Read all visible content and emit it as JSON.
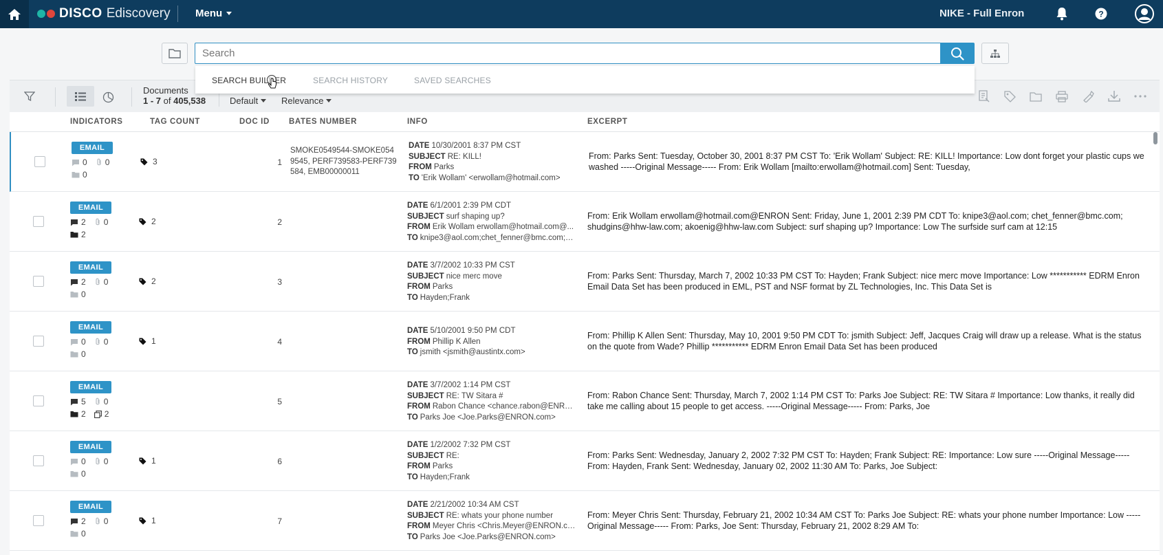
{
  "topbar": {
    "brand": "DISCO",
    "product": "Ediscovery",
    "menu_label": "Menu",
    "workspace": "NIKE - Full Enron",
    "icons": [
      "home-icon",
      "bell-icon",
      "help-icon",
      "user-avatar-icon"
    ],
    "colors": {
      "bar": "#0e3c5e",
      "logo_teal": "#1fb5a6",
      "logo_red": "#e0463c"
    }
  },
  "search": {
    "placeholder": "Search",
    "tabs": [
      "SEARCH BUILDER",
      "SEARCH HISTORY",
      "SAVED SEARCHES"
    ]
  },
  "toolbar": {
    "documents_label": "Documents",
    "range": "1 - 7",
    "of": "of",
    "total": "405,538",
    "sort_view": "Default",
    "sort_order": "Relevance"
  },
  "columns": [
    "INDICATORS",
    "TAG COUNT",
    "DOC ID",
    "BATES NUMBER",
    "INFO",
    "EXCERPT"
  ],
  "rows": [
    {
      "type": "EMAIL",
      "notes": "0",
      "attachments": "0",
      "folders": "0",
      "tag_count": "3",
      "doc_id": "1",
      "bates": "SMOKE0549544-SMOKE0549545, PERF739583-PERF739584, EMB00000011",
      "date": "10/30/2001 8:37 PM CST",
      "subject": "RE: KILL!",
      "from": "Parks",
      "to": "'Erik Wollam' <erwollam@hotmail.com>",
      "excerpt": "From: Parks Sent: Tuesday, October 30, 2001 8:37 PM CST To: 'Erik Wollam' Subject: RE: KILL! Importance: Low dont forget your plastic cups we washed -----Original Message----- From: Erik Wollam [mailto:erwollam@hotmail.com] Sent: Tuesday,"
    },
    {
      "type": "EMAIL",
      "notes": "2",
      "attachments": "0",
      "folders": "2",
      "tag_count": "2",
      "doc_id": "2",
      "bates": "",
      "date": "6/1/2001 2:39 PM CDT",
      "subject": "surf shaping up?",
      "from": "Erik Wollam erwollam@hotmail.com@...",
      "to": "knipe3@aol.com;chet_fenner@bmc.com;s...",
      "excerpt": "From: Erik Wollam erwollam@hotmail.com@ENRON Sent: Friday, June 1, 2001 2:39 PM CDT To: knipe3@aol.com; chet_fenner@bmc.com; shudgins@hhw-law.com; akoenig@hhw-law.com Subject: surf shaping up? Importance: Low The surfside surf cam at 12:15"
    },
    {
      "type": "EMAIL",
      "notes": "2",
      "attachments": "0",
      "folders": "0",
      "tag_count": "2",
      "doc_id": "3",
      "bates": "",
      "date": "3/7/2002 10:33 PM CST",
      "subject": "nice merc move",
      "from": "Parks",
      "to": "Hayden;Frank",
      "excerpt": "From: Parks Sent: Thursday, March 7, 2002 10:33 PM CST To: Hayden; Frank Subject: nice merc move Importance: Low *********** EDRM Enron Email Data Set has been produced in EML, PST and NSF format by ZL Technologies, Inc. This Data Set is"
    },
    {
      "type": "EMAIL",
      "notes": "0",
      "attachments": "0",
      "folders": "0",
      "tag_count": "1",
      "doc_id": "4",
      "bates": "",
      "date": "5/10/2001 9:50 PM CDT",
      "subject": "",
      "from": "Phillip K Allen",
      "to": "jsmith <jsmith@austintx.com>",
      "excerpt": "From: Phillip K Allen Sent: Thursday, May 10, 2001 9:50 PM CDT To: jsmith Subject: Jeff, Jacques Craig will draw up a release. What is the status on the quote from Wade? Phillip *********** EDRM Enron Email Data Set has been produced"
    },
    {
      "type": "EMAIL",
      "notes": "5",
      "attachments": "0",
      "folders": "2",
      "duplicates": "2",
      "tag_count": "",
      "doc_id": "5",
      "bates": "",
      "date": "3/7/2002 1:14 PM CST",
      "subject": "RE: TW Sitara #",
      "from": "Rabon Chance <chance.rabon@ENRO...",
      "to": "Parks Joe <Joe.Parks@ENRON.com>",
      "excerpt": "From: Rabon Chance Sent: Thursday, March 7, 2002 1:14 PM CST To: Parks Joe Subject: RE: TW Sitara # Importance: Low thanks, it really did take me calling about 15 people to get access. -----Original Message----- From: Parks, Joe"
    },
    {
      "type": "EMAIL",
      "notes": "0",
      "attachments": "0",
      "folders": "0",
      "tag_count": "1",
      "doc_id": "6",
      "bates": "",
      "date": "1/2/2002 7:32 PM CST",
      "subject": "RE:",
      "from": "Parks",
      "to": "Hayden;Frank",
      "excerpt": "From: Parks Sent: Wednesday, January 2, 2002 7:32 PM CST To: Hayden; Frank Subject: RE: Importance: Low sure -----Original Message----- From: Hayden, Frank Sent: Wednesday, January 02, 2002 11:30 AM To: Parks, Joe Subject:"
    },
    {
      "type": "EMAIL",
      "notes": "2",
      "attachments": "0",
      "folders": "0",
      "tag_count": "1",
      "doc_id": "7",
      "bates": "",
      "date": "2/21/2002 10:34 AM CST",
      "subject": "RE: whats your phone number",
      "from": "Meyer Chris <Chris.Meyer@ENRON.co...",
      "to": "Parks Joe <Joe.Parks@ENRON.com>",
      "excerpt": "From: Meyer Chris Sent: Thursday, February 21, 2002 10:34 AM CST To: Parks Joe Subject: RE: whats your phone number Importance: Low ----- Original Message----- From: Parks, Joe Sent: Thursday, February 21, 2002 8:29 AM To:"
    }
  ],
  "info_keys": {
    "date": "DATE",
    "subject": "SUBJECT",
    "from": "FROM",
    "to": "TO"
  }
}
